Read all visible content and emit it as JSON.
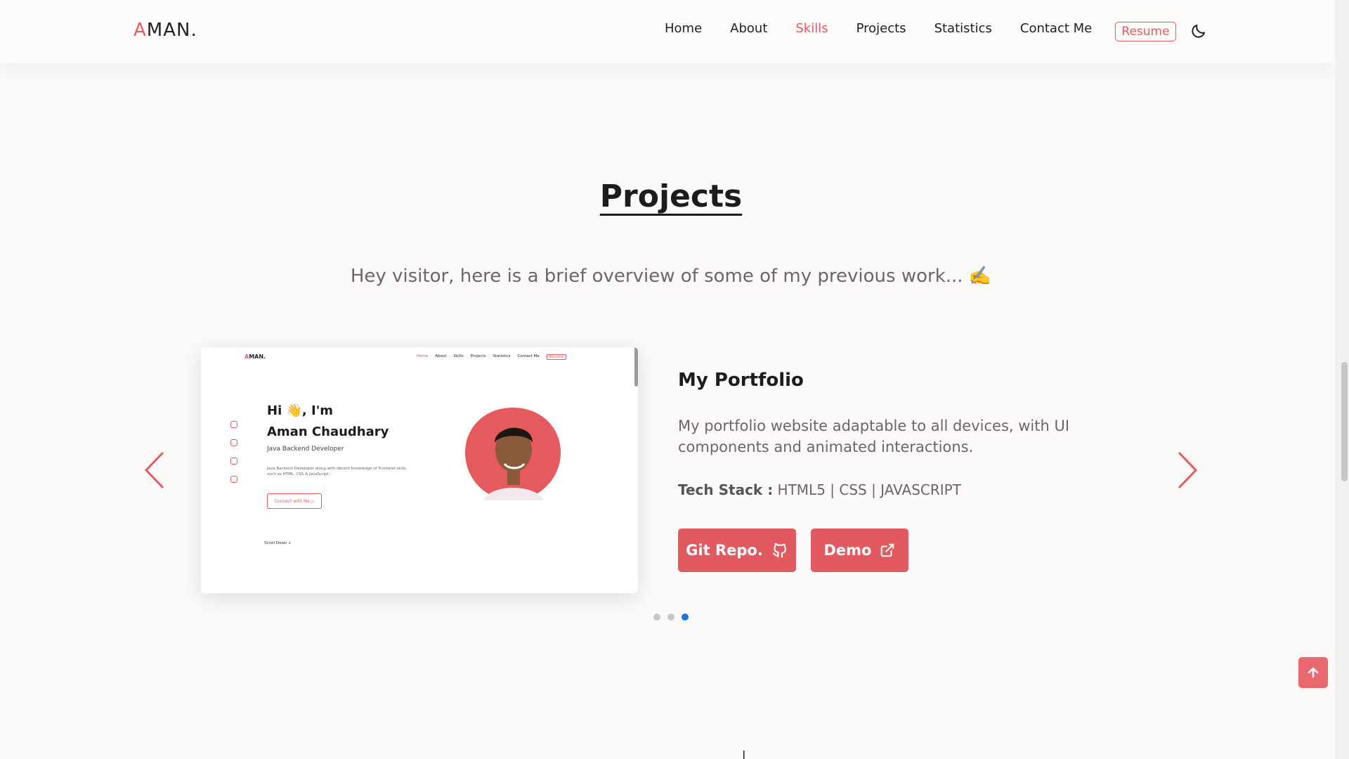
{
  "nav": {
    "logo_accent": "A",
    "logo_rest": "MAN.",
    "links": [
      "Home",
      "About",
      "Skills",
      "Projects",
      "Statistics",
      "Contact Me"
    ],
    "active_link": "Skills",
    "resume_label": "Resume",
    "theme_icon": "moon-icon"
  },
  "section": {
    "title": "Projects",
    "subtitle": "Hey visitor, here is a brief overview of some of my previous work... ✍️"
  },
  "project": {
    "title": "My Portfolio",
    "description": "My portfolio website adaptable to all devices, with UI components and animated interactions.",
    "tech_label": "Tech Stack :",
    "tech_value": " HTML5 | CSS | JAVASCRIPT",
    "git_label": "Git Repo.",
    "demo_label": "Demo"
  },
  "preview": {
    "logo_accent": "A",
    "logo_rest": "MAN.",
    "links": [
      "Home",
      "About",
      "Skills",
      "Projects",
      "Statistics",
      "Contact Me"
    ],
    "resume": "Resume",
    "greet_line1": "Hi 👋, I'm",
    "greet_line2": "Aman Chaudhary",
    "role": "Java Backend Developer",
    "desc": "Java Backend Developer along with decent knowledge of Frontend skills such as HTML, CSS & JavaScript.",
    "cta": "Connect with Me ▷",
    "scroll": "Scroll Down ↓"
  },
  "carousel": {
    "slides": 3,
    "active_index": 2
  },
  "colors": {
    "accent": "#e55a5f",
    "button": "#e15a5f",
    "dot_active": "#1a73e8"
  }
}
